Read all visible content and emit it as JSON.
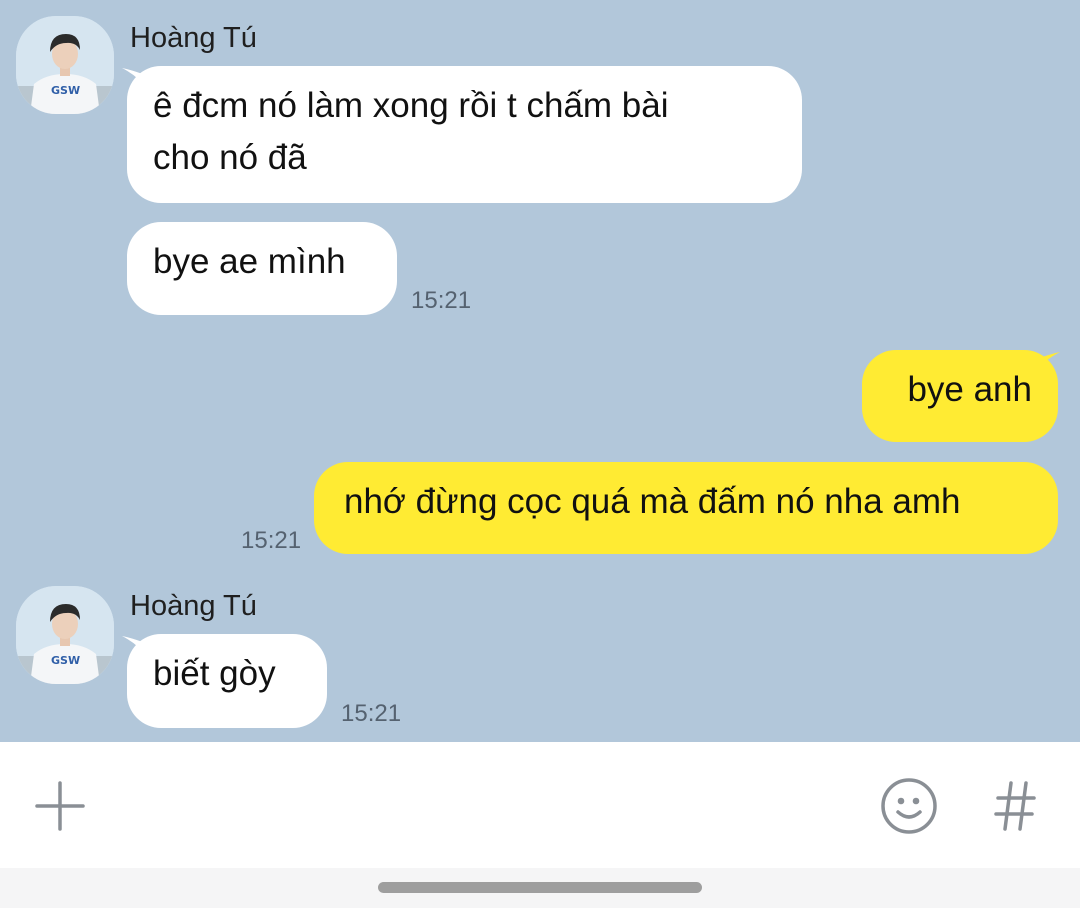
{
  "messages": [
    {
      "sender": "Hoàng Tú",
      "text_line1": "ê đcm nó làm xong rồi t chấm bài",
      "text_line2": "cho nó đã"
    },
    {
      "text": "bye ae mình",
      "time": "15:21"
    },
    {
      "text": "bye anh"
    },
    {
      "text": "nhớ đừng cọc quá mà đấm nó nha amh",
      "time": "15:21"
    },
    {
      "sender": "Hoàng Tú",
      "text": "biết gòy",
      "time": "15:21"
    }
  ],
  "avatar": {
    "shirt_text": "GSW"
  },
  "input_bar": {
    "left_icon": "plus-icon",
    "right_icons": [
      "emoji-icon",
      "hashtag-icon"
    ]
  },
  "colors": {
    "background": "#b2c7da",
    "incoming_bubble": "#ffffff",
    "outgoing_bubble": "#ffeb33",
    "icon_gray": "#8a8f95"
  }
}
